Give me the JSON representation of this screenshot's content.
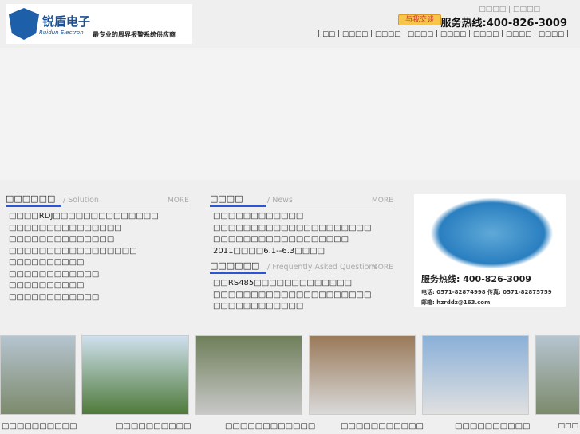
{
  "header": {
    "logo_name": "锐盾电子",
    "logo_en": "Ruidun Electron",
    "slogan": "最专业的周界报警系统供应商",
    "top_links": [
      "□□□□",
      "□□□□"
    ],
    "qq_label": "与我交谈",
    "hotline": "服务热线:400-826-3009",
    "nav": [
      "□□",
      "□□□□",
      "□□□□",
      "□□□□",
      "□□□□",
      "□□□□",
      "□□□□",
      "□□□□"
    ]
  },
  "solution": {
    "title": "□□□□□□",
    "subtitle": "/ Solution",
    "more": "MORE",
    "items": [
      "□□□□RDJ□□□□□□□□□□□□□□",
      "□□□□□□□□□□□□□□□",
      "□□□□□□□□□□□□□□",
      "□□□□□□□□□□□□□□□□□",
      "□□□□□□□□□□",
      "□□□□□□□□□□□□",
      "□□□□□□□□□□",
      "□□□□□□□□□□□□"
    ]
  },
  "news": {
    "title": "□□□□",
    "subtitle": "/ News",
    "more": "MORE",
    "items": [
      "□□□□□□□□□□□□",
      "□□□□□□□□□□□□□□□□□□□□□",
      "□□□□□□□□□□□□□□□□□□",
      "2011□□□□6.1--6.3□□□□"
    ]
  },
  "faq": {
    "title": "□□□□□□",
    "subtitle": "/ Frequently Asked Questions",
    "more": "MORE",
    "items": [
      "□□RS485□□□□□□□□□□□□□",
      "□□□□□□□□□□□□□□□□□□□□□",
      "□□□□□□□□□□□□"
    ]
  },
  "contact": {
    "hotline": "服务热线: 400-826-3009",
    "phone": "电话: 0571-82874998 传真: 0571-82875759",
    "email": "邮箱: hzrddz@163.com"
  },
  "photos": [
    "□□□□□□□□□□",
    "□□□□□□□□□□",
    "□□□□□□□□□□□□",
    "□□□□□□□□□□□",
    "□□□□□□□□□□",
    "□□□"
  ]
}
